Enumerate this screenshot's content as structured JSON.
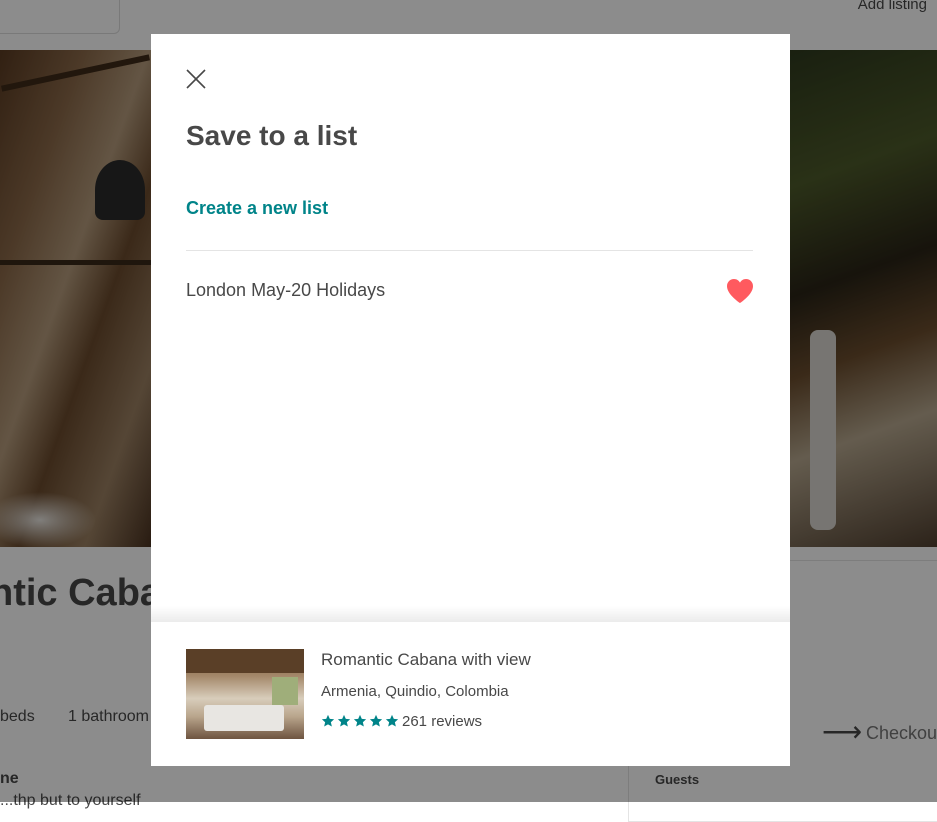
{
  "background": {
    "header": {
      "add_listing": "Add listing"
    },
    "listing_title_fragment": "ntic Caba",
    "beds_fragment": "beds",
    "bathroom_fragment": "1 bathroom",
    "section_fragment": "ne",
    "text_fragment": "...thp but to yourself",
    "checkout_label": "Checkout",
    "guests_label": "Guests"
  },
  "modal": {
    "title": "Save to a list",
    "create_link": "Create a new list",
    "lists": [
      {
        "name": "London May-20 Holidays",
        "saved": true
      }
    ],
    "listing": {
      "title": "Romantic Cabana with view",
      "location": "Armenia, Quindio, Colombia",
      "rating_stars": 5,
      "reviews": "261 reviews"
    }
  },
  "colors": {
    "accent_teal": "#008489",
    "heart_red": "#FF5A5F",
    "text": "#484848"
  },
  "icons": {
    "close": "close-icon",
    "heart": "heart-icon",
    "star": "star-icon"
  }
}
